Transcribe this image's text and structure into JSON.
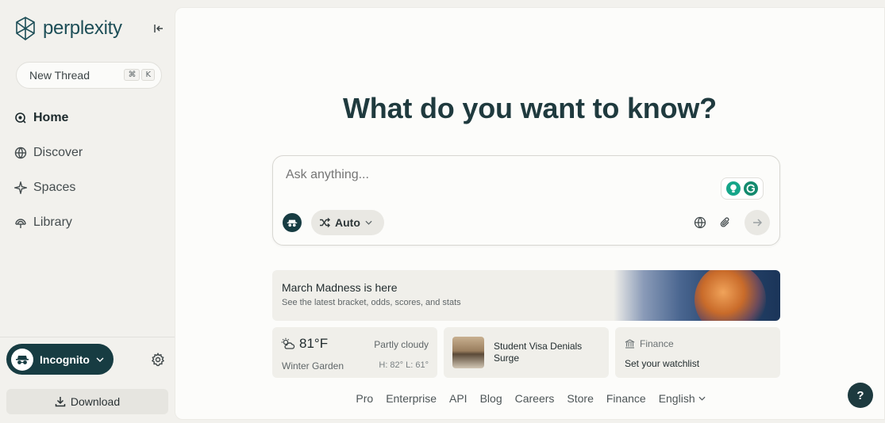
{
  "sidebar": {
    "logo_text": "perplexity",
    "new_thread": {
      "label": "New Thread",
      "shortcut_keys": [
        "⌘",
        "K"
      ]
    },
    "nav": [
      {
        "label": "Home",
        "icon": "search-circle-icon",
        "active": true
      },
      {
        "label": "Discover",
        "icon": "globe-icon",
        "active": false
      },
      {
        "label": "Spaces",
        "icon": "sparkle-icon",
        "active": false
      },
      {
        "label": "Library",
        "icon": "library-icon",
        "active": false
      }
    ],
    "account": {
      "label": "Incognito"
    },
    "download_label": "Download"
  },
  "main": {
    "title": "What do you want to know?",
    "ask": {
      "placeholder": "Ask anything...",
      "mode_label": "Auto"
    },
    "promo": {
      "title": "March Madness is here",
      "subtitle": "See the latest bracket, odds, scores, and stats"
    },
    "weather": {
      "temp": "81°F",
      "condition": "Partly cloudy",
      "location": "Winter Garden",
      "high_low": "H: 82° L: 61°"
    },
    "news": {
      "title": "Student Visa Denials Surge"
    },
    "finance": {
      "title": "Finance",
      "subtitle": "Set your watchlist"
    },
    "footer_links": [
      "Pro",
      "Enterprise",
      "API",
      "Blog",
      "Careers",
      "Store",
      "Finance"
    ],
    "language": "English",
    "help_label": "?"
  },
  "colors": {
    "brand_teal": "#1d4e57",
    "incognito_bg": "#173c42",
    "page_bg": "#f2f1ed",
    "main_bg": "#fcfcfa"
  }
}
